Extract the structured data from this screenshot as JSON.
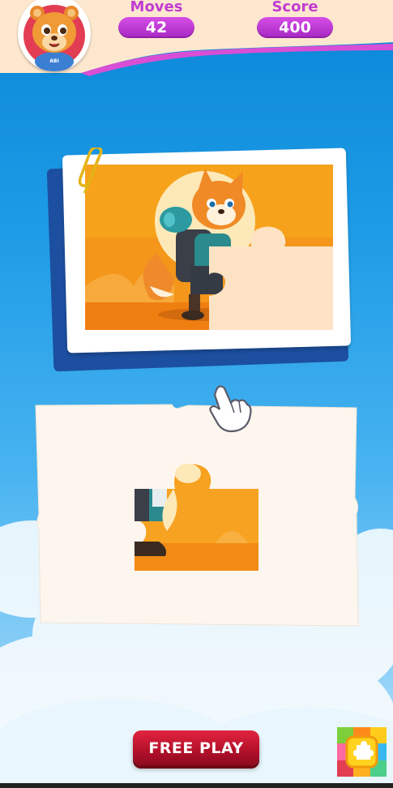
{
  "hud": {
    "moves_label": "Moves",
    "moves_value": "42",
    "score_label": "Score",
    "score_value": "400",
    "avatar_badge": "ABI"
  },
  "free_play": {
    "label": "FREE PLAY"
  },
  "colors": {
    "accent_purple": "#b533cc",
    "sky_blue": "#1f9ce6",
    "button_red": "#c8172f",
    "board_cream": "#fdf6ee"
  },
  "icons": [
    "avatar-bear-icon",
    "paperclip-icon",
    "pointer-hand-icon",
    "puzzle-app-icon"
  ]
}
